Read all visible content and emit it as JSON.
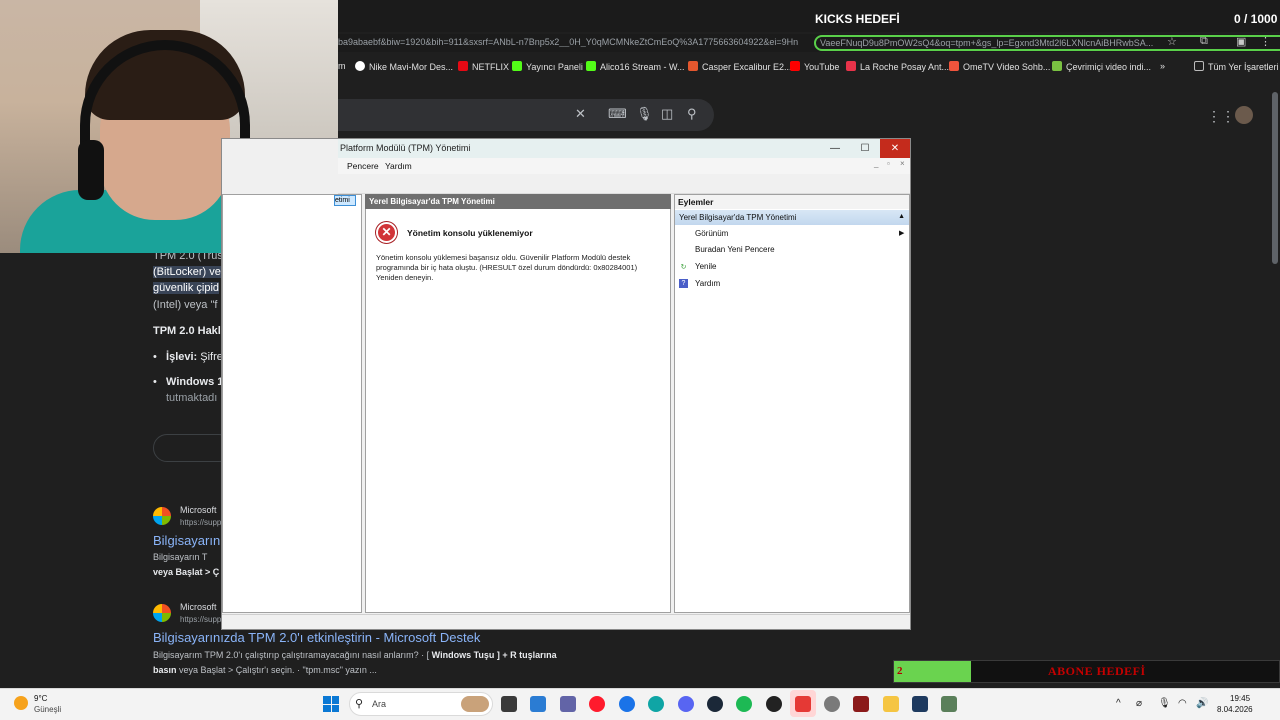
{
  "overlay": {
    "kicks_label": "KICKS HEDEFİ",
    "kicks_count": "0 / 1000",
    "abone_number": "2",
    "abone_label": "ABONE HEDEFİ",
    "abone_progress": 0.2
  },
  "browser": {
    "url": "ba9abaebf&biw=1920&bih=911&sxsrf=ANbL-n7Bnp5x2__0H_Y0qMCMNkeZtCmEoQ%3A1775663604922&ei=9Hn",
    "url_highlight": "VaeeFNuqD9u8PmOW2sQ4&oq=tpm+&gs_lp=Egxnd3Mtd2l6LXNlcnAiBHRwbSA...",
    "bookmarks": [
      {
        "label": "m",
        "color": "#1f1f1f"
      },
      {
        "label": "Nike Mavi-Mor Des...",
        "color": "#ffffff"
      },
      {
        "label": "NETFLIX",
        "color": "#e50914"
      },
      {
        "label": "Yayıncı Paneli",
        "color": "#53fc18"
      },
      {
        "label": "Alico16 Stream - W...",
        "color": "#53fc18"
      },
      {
        "label": "Casper Excalibur E2...",
        "color": "#e4572e"
      },
      {
        "label": "YouTube",
        "color": "#ff0000"
      },
      {
        "label": "La Roche Posay Ant...",
        "color": "#e8334a"
      },
      {
        "label": "OmeTV Video Sohb...",
        "color": "#f0543c"
      },
      {
        "label": "Çevrimiçi video indi...",
        "color": "#7ac142"
      }
    ],
    "all_bookmarks": "Tüm Yer İşaretleri",
    "more": "»"
  },
  "results": {
    "line1": "TPM 2.0 (Trus",
    "line2": "(BitLocker) ve",
    "line3": "güvenlik çipid",
    "line4": "(Intel) veya \"f",
    "heading": "TPM 2.0 Hakl",
    "bullet1_bold": "İşlevi:",
    "bullet1_rest": " Şifre",
    "bullet2_bold": "Windows 1",
    "bullet2_sub": "tutmaktadı",
    "site1_name": "Microsoft",
    "site1_url": "https://supp",
    "title1": "Bilgisayarın",
    "snippet1a": "Bilgisayarın T",
    "snippet1b": "veya Başlat > Ç",
    "site2_name": "Microsoft",
    "site2_url": "https://supp",
    "title2": "Bilgisayarınızda TPM 2.0'ı etkinleştirin - Microsoft Destek",
    "snippet2a_pre": "Bilgisayarım TPM 2.0'ı çalıştırıp çalıştıramayacağını nasıl anlarım? · [ ",
    "snippet2a_bold": "Windows Tuşu ] + R tuşlarına",
    "snippet2b_bold": "basın",
    "snippet2b_rest": " veya Başlat > Çalıştır'ı seçin. · \"tpm.msc\" yazın ..."
  },
  "mmc": {
    "title": "Platform Modülü (TPM) Yönetimi",
    "menu": [
      "Pencere",
      "Yardım"
    ],
    "tree_selected": "etimi",
    "center_header": "Yerel Bilgisayar'da TPM Yönetimi",
    "error_title": "Yönetim konsolu yüklenemiyor",
    "error_body": "Yönetim konsolu yüklemesi başarısız oldu. Güvenilir Platform Modülü destek programında bir iç hata oluştu. (HRESULT özel durum döndürdü: 0x80284001) Yeniden deneyin.",
    "actions_header": "Eylemler",
    "actions_group": "Yerel Bilgisayar'da TPM Yönetimi",
    "actions": [
      "Görünüm",
      "Buradan Yeni Pencere",
      "Yenile",
      "Yardım"
    ]
  },
  "taskbar": {
    "temp": "9°C",
    "weather": "Güneşli",
    "search": "Ara",
    "time": "19:45",
    "date": "8.04.2026"
  }
}
